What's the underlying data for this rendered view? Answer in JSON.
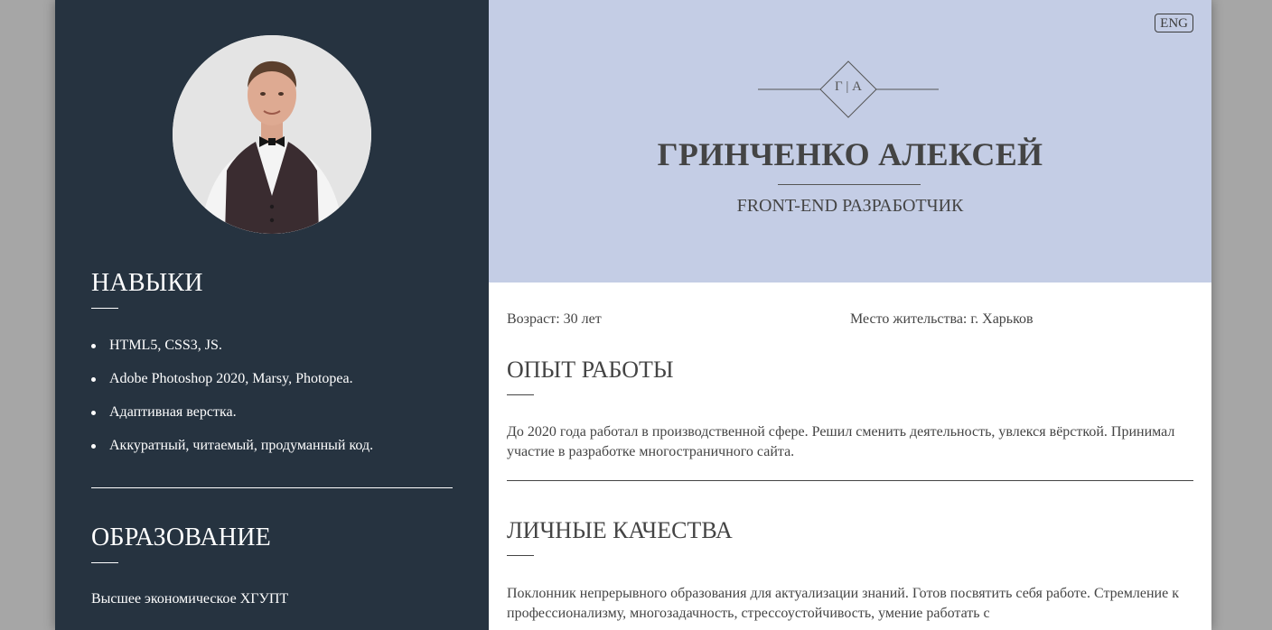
{
  "profile": {
    "monogram": "Г | А",
    "name": "ГРИНЧЕНКО АЛЕКСЕЙ",
    "role": "FRONT-END РАЗРАБОТЧИК",
    "age": "Возраст: 30 лет",
    "city": "Место жительства: г. Харьков"
  },
  "header": {
    "lang_button": "ENG"
  },
  "sidebar": {
    "skills_title": "НАВЫКИ",
    "skills": [
      "HTML5, CSS3, JS.",
      "Adobe Photoshop 2020, Marsy, Photopea.",
      "Адаптивная верстка.",
      "Аккуратный, читаемый, продуманный код."
    ],
    "education_title": "ОБРАЗОВАНИЕ",
    "education_text": "Высшее экономическое ХГУПТ"
  },
  "experience": {
    "title": "ОПЫТ РАБОТЫ",
    "text": "До 2020 года работал в производственной сфере. Решил сменить деятельность, увлекся вёрсткой. Принимал участие в разработке многостраничного сайта."
  },
  "qualities": {
    "title": "ЛИЧНЫЕ КАЧЕСТВА",
    "text": "Поклонник непрерывного образования для актуализации знаний. Готов посвятить себя работе. Стремление к профессионализму, многозадачность, стрессоустойчивость, умение работать с"
  },
  "colors": {
    "sidebar_bg": "#263340",
    "header_bg": "#c4cde5",
    "text": "#444444",
    "page_bg": "#a6a6a6"
  }
}
